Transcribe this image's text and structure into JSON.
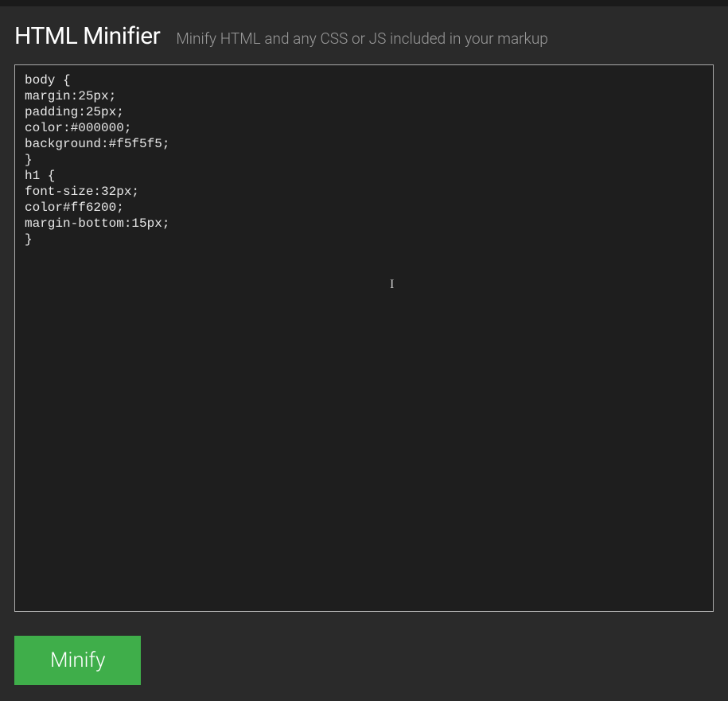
{
  "header": {
    "title": "HTML Minifier",
    "subtitle": "Minify HTML and any CSS or JS included in your markup"
  },
  "editor": {
    "value": "body {\nmargin:25px;\npadding:25px;\ncolor:#000000;\nbackground:#f5f5f5;\n}\nh1 {\nfont-size:32px;\ncolor#ff6200;\nmargin-bottom:15px;\n}"
  },
  "actions": {
    "minify_label": "Minify"
  }
}
